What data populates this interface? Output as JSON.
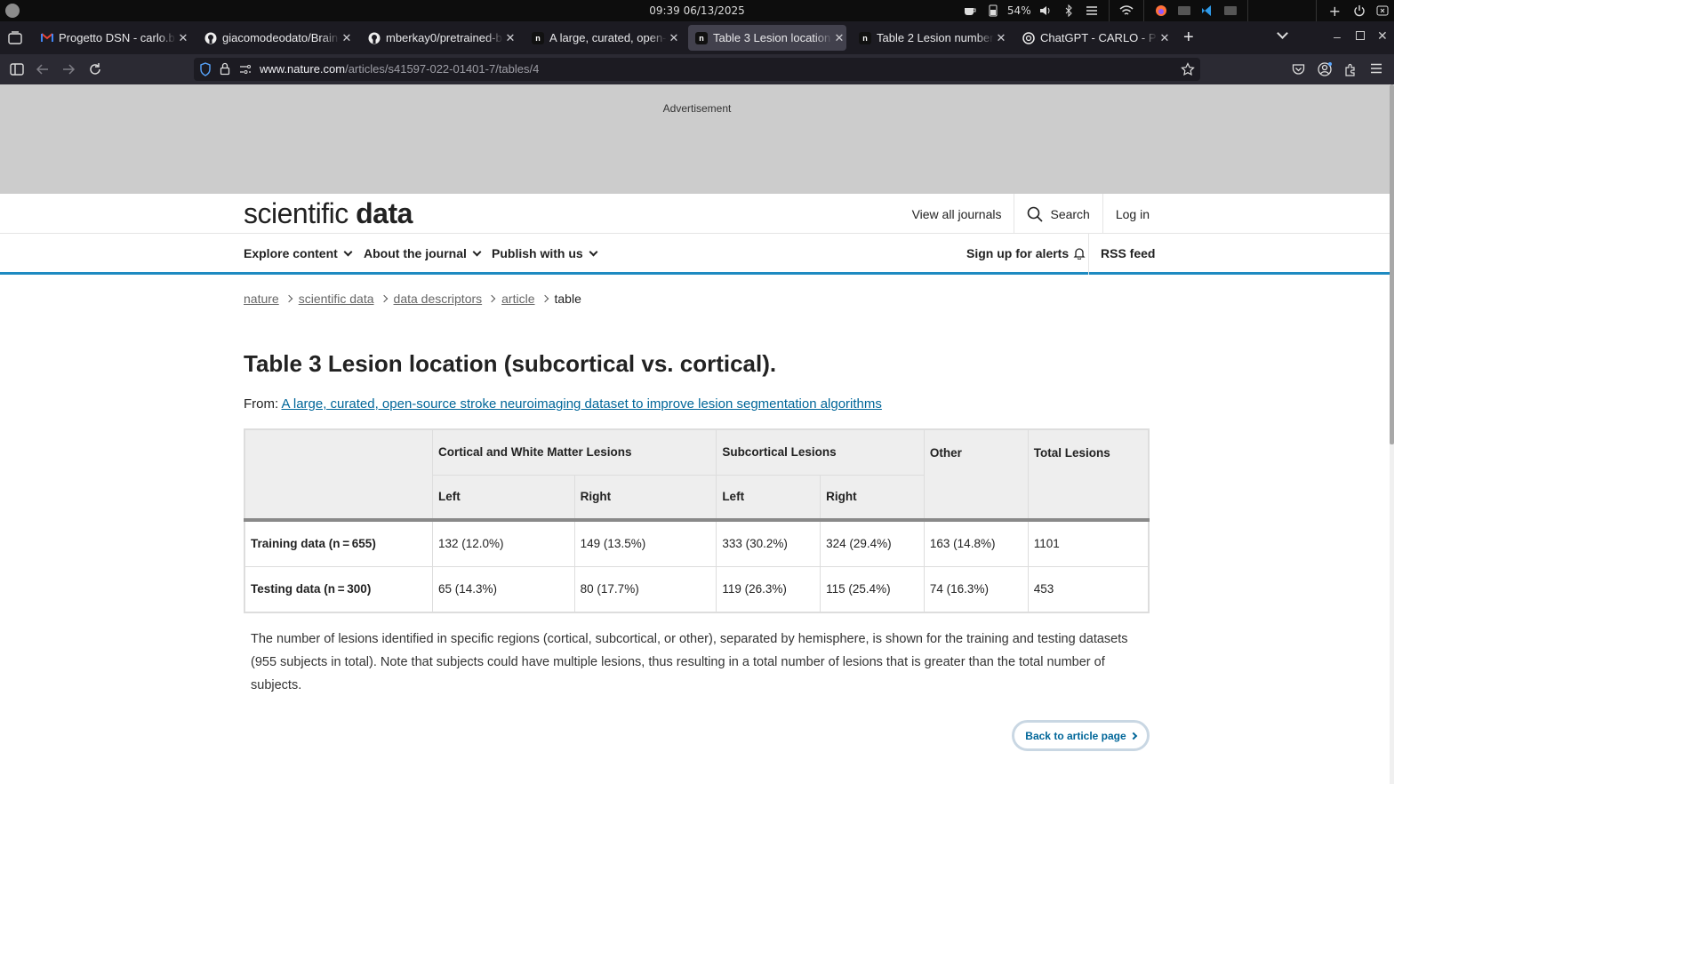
{
  "os": {
    "clock": "09:39 06/13/2025",
    "battery": "54%"
  },
  "tabs": [
    {
      "title": "Progetto DSN - carlo.bia",
      "icon": "gmail-icon",
      "active": false
    },
    {
      "title": "giacomodeodato/Brain-l",
      "icon": "github-icon",
      "active": false
    },
    {
      "title": "mberkay0/pretrained-ba",
      "icon": "github-icon",
      "active": false
    },
    {
      "title": "A large, curated, open-so",
      "icon": "nature-icon",
      "active": false
    },
    {
      "title": "Table 3 Lesion location (s",
      "icon": "nature-icon",
      "active": true
    },
    {
      "title": "Table 2 Lesion number a",
      "icon": "nature-icon",
      "active": false
    },
    {
      "title": "ChatGPT - CARLO - Prog",
      "icon": "chatgpt-icon",
      "active": false
    }
  ],
  "urlbar": {
    "host": "www.nature.com",
    "path": "/articles/s41597-022-01401-7/tables/4"
  },
  "ad": {
    "label": "Advertisement"
  },
  "header": {
    "logo_light": "scientific",
    "logo_bold": "data",
    "view_all": "View all journals",
    "search": "Search",
    "login": "Log in"
  },
  "menu": {
    "explore": "Explore content",
    "about": "About the journal",
    "publish": "Publish with us",
    "alerts": "Sign up for alerts",
    "rss": "RSS feed"
  },
  "breadcrumb": [
    "nature",
    "scientific data",
    "data descriptors",
    "article",
    "table"
  ],
  "title": "Table 3 Lesion location (subcortical vs. cortical).",
  "from": {
    "label": "From:",
    "link": "A large, curated, open-source stroke neuroimaging dataset to improve lesion segmentation algorithms"
  },
  "table": {
    "groups": {
      "cortical": "Cortical and White Matter Lesions",
      "subcortical": "Subcortical Lesions",
      "other": "Other",
      "total": "Total Lesions"
    },
    "sub": {
      "left": "Left",
      "right": "Right"
    },
    "rows": [
      {
        "label": "Training data (n = 655)",
        "cells": [
          "132 (12.0%)",
          "149 (13.5%)",
          "333 (30.2%)",
          "324 (29.4%)",
          "163 (14.8%)",
          "1101"
        ]
      },
      {
        "label": "Testing data (n = 300)",
        "cells": [
          "65 (14.3%)",
          "80 (17.7%)",
          "119 (26.3%)",
          "115 (25.4%)",
          "74 (16.3%)",
          "453"
        ]
      }
    ]
  },
  "caption": "The number of lesions identified in specific regions (cortical, subcortical, or other), separated by hemisphere, is shown for the training and testing datasets (955 subjects in total). Note that subjects could have multiple lesions, thus resulting in a total number of lesions that is greater than the total number of subjects.",
  "back_button": "Back to article page"
}
